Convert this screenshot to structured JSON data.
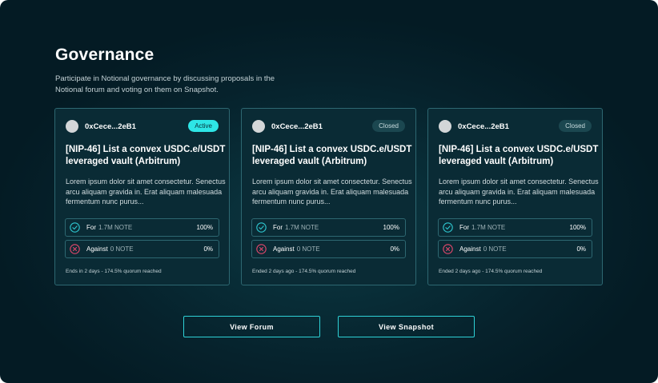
{
  "page": {
    "title": "Governance",
    "subtitle": "Participate in Notional governance by discussing proposals in the Notional forum and voting on them on Snapshot."
  },
  "colors": {
    "accent": "#2ee6e6",
    "for_icon": "#2ec6cf",
    "against_icon": "#e0476b"
  },
  "proposals": [
    {
      "author": "0xCece...2eB1",
      "status": "Active",
      "title": "[NIP-46] List a convex USDC.e/USDT leveraged vault (Arbitrum)",
      "description": "Lorem ipsum dolor sit amet consectetur. Senectus arcu aliquam gravida in. Erat aliquam malesuada fermentum nunc purus...",
      "for": {
        "label": "For",
        "amount": "1.7M NOTE",
        "percent": "100%",
        "icon": "check-circle-icon"
      },
      "against": {
        "label": "Against",
        "amount": "0 NOTE",
        "percent": "0%",
        "icon": "x-circle-icon"
      },
      "footer": "Ends in 2 days - 174.5% quorum reached"
    },
    {
      "author": "0xCece...2eB1",
      "status": "Closed",
      "title": "[NIP-46] List a convex USDC.e/USDT leveraged vault (Arbitrum)",
      "description": "Lorem ipsum dolor sit amet consectetur. Senectus arcu aliquam gravida in. Erat aliquam malesuada fermentum nunc purus...",
      "for": {
        "label": "For",
        "amount": "1.7M NOTE",
        "percent": "100%",
        "icon": "check-circle-icon"
      },
      "against": {
        "label": "Against",
        "amount": "0 NOTE",
        "percent": "0%",
        "icon": "x-circle-icon"
      },
      "footer": "Ended 2 days ago - 174.5% quorum reached"
    },
    {
      "author": "0xCece...2eB1",
      "status": "Closed",
      "title": "[NIP-46] List a convex USDC.e/USDT leveraged vault (Arbitrum)",
      "description": "Lorem ipsum dolor sit amet consectetur. Senectus arcu aliquam gravida in. Erat aliquam malesuada fermentum nunc purus...",
      "for": {
        "label": "For",
        "amount": "1.7M NOTE",
        "percent": "100%",
        "icon": "check-circle-icon"
      },
      "against": {
        "label": "Against",
        "amount": "0 NOTE",
        "percent": "0%",
        "icon": "x-circle-icon"
      },
      "footer": "Ended 2 days ago - 174.5% quorum reached"
    }
  ],
  "actions": {
    "view_forum": "View Forum",
    "view_snapshot": "View Snapshot"
  }
}
